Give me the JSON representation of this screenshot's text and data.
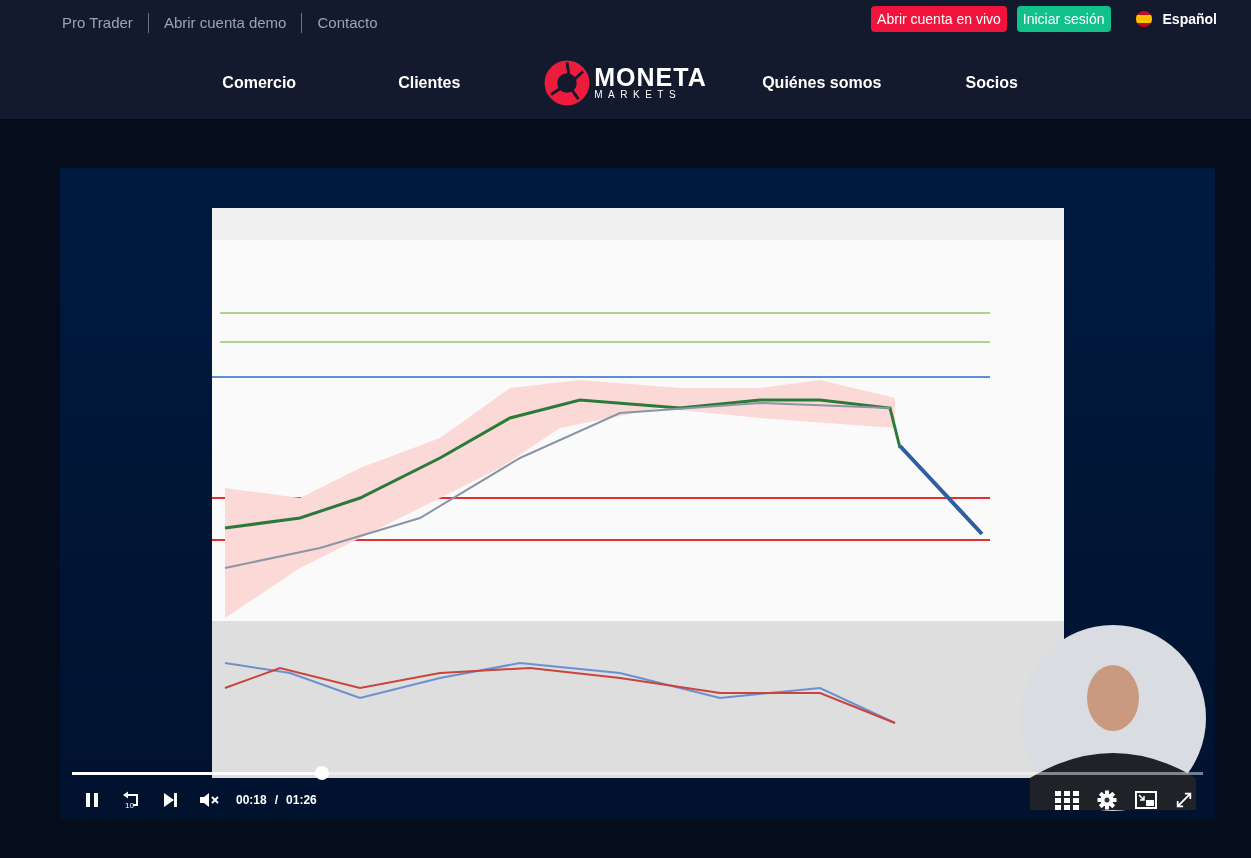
{
  "top_links": [
    "Pro Trader",
    "Abrir cuenta demo",
    "Contacto"
  ],
  "account_buttons": [
    {
      "label": "Abrir cuenta en vivo",
      "kind": "live"
    },
    {
      "label": "Iniciar sesión",
      "kind": "login"
    }
  ],
  "language": "Español",
  "nav_left": [
    "Comercio",
    "Clientes"
  ],
  "logo": {
    "name": "MONETA",
    "sub": "MARKETS"
  },
  "nav_right": [
    "Quiénes somos",
    "Socios"
  ],
  "video": {
    "kind": "picture",
    "playing": true,
    "muted": true,
    "replay_seconds": "10",
    "current_time": "00:18",
    "separator": "/",
    "duration": "01:26",
    "progress": {
      "level": 0.218
    }
  }
}
